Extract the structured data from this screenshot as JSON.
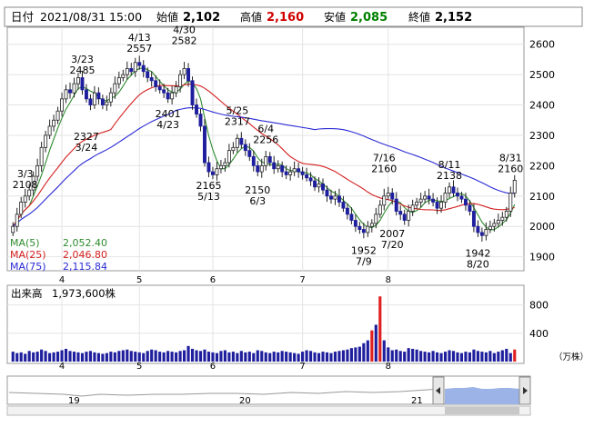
{
  "header": {
    "date_label": "日付",
    "datetime": "2021/08/31 15:00",
    "open_label": "始値",
    "open": "2,102",
    "high_label": "高値",
    "high": "2,160",
    "low_label": "安値",
    "low": "2,085",
    "close_label": "終値",
    "close": "2,152"
  },
  "colors": {
    "up": "#ffffff",
    "down": "#1f1f9e",
    "ma5": "#2e8b2e",
    "ma25": "#d42020",
    "ma75": "#2a2ad4",
    "high_value": "#d00000",
    "low_value": "#008000",
    "volume": "#1f1f9e",
    "volume_highlight": "#e02020",
    "navigator_fill": "#9bb3e6"
  },
  "legend": [
    {
      "label": "MA(5)",
      "value": "2,052.40",
      "color": "#2e8b2e"
    },
    {
      "label": "MA(25)",
      "value": "2,046.80",
      "color": "#d42020"
    },
    {
      "label": "MA(75)",
      "value": "2,115.84",
      "color": "#2a2ad4"
    }
  ],
  "volume_panel": {
    "label": "出来高",
    "value": "1,973,600株",
    "unit": "（万株）"
  },
  "chart_data": {
    "type": "candlestick",
    "y_ticks": [
      1900,
      2000,
      2100,
      2200,
      2300,
      2400,
      2500,
      2600
    ],
    "ylim": [
      1860,
      2650
    ],
    "x_month_labels": [
      {
        "label": "4",
        "index": 12
      },
      {
        "label": "5",
        "index": 31
      },
      {
        "label": "6",
        "index": 49
      },
      {
        "label": "7",
        "index": 71
      },
      {
        "label": "8",
        "index": 92
      }
    ],
    "annotations": [
      {
        "lines": [
          "3/3",
          "2108"
        ],
        "index": 3,
        "price": 2108
      },
      {
        "lines": [
          "3/23",
          "2485"
        ],
        "index": 17,
        "price": 2485
      },
      {
        "lines": [
          "2327",
          "3/24"
        ],
        "index": 18,
        "price": 2327
      },
      {
        "lines": [
          "4/13",
          "2557"
        ],
        "index": 31,
        "price": 2557
      },
      {
        "lines": [
          "2401",
          "4/23"
        ],
        "index": 38,
        "price": 2401
      },
      {
        "lines": [
          "4/30",
          "2582"
        ],
        "index": 42,
        "price": 2582
      },
      {
        "lines": [
          "2165",
          "5/13"
        ],
        "index": 48,
        "price": 2165
      },
      {
        "lines": [
          "5/25",
          "2317"
        ],
        "index": 55,
        "price": 2317
      },
      {
        "lines": [
          "6/4",
          "2256"
        ],
        "index": 62,
        "price": 2256
      },
      {
        "lines": [
          "2150",
          "6/3"
        ],
        "index": 60,
        "price": 2150
      },
      {
        "lines": [
          "1952",
          "7/9"
        ],
        "index": 86,
        "price": 1952
      },
      {
        "lines": [
          "7/16",
          "2160"
        ],
        "index": 91,
        "price": 2160
      },
      {
        "lines": [
          "2007",
          "7/20"
        ],
        "index": 93,
        "price": 2007
      },
      {
        "lines": [
          "8/11",
          "2138"
        ],
        "index": 107,
        "price": 2138
      },
      {
        "lines": [
          "1942",
          "8/20"
        ],
        "index": 114,
        "price": 1942
      },
      {
        "lines": [
          "8/31",
          "2160"
        ],
        "index": 122,
        "price": 2160
      }
    ],
    "volume_ticks": [
      400,
      800
    ],
    "volume_max": 1000,
    "volume_highlight_index": 90,
    "closes": [
      2000,
      2040,
      2080,
      2100,
      2120,
      2165,
      2200,
      2260,
      2300,
      2330,
      2350,
      2380,
      2420,
      2450,
      2440,
      2470,
      2490,
      2450,
      2420,
      2400,
      2440,
      2420,
      2400,
      2410,
      2440,
      2470,
      2490,
      2500,
      2520,
      2510,
      2540,
      2530,
      2510,
      2490,
      2480,
      2460,
      2450,
      2440,
      2420,
      2440,
      2460,
      2500,
      2520,
      2480,
      2400,
      2370,
      2330,
      2210,
      2180,
      2170,
      2190,
      2200,
      2210,
      2250,
      2260,
      2290,
      2270,
      2250,
      2230,
      2200,
      2180,
      2200,
      2230,
      2210,
      2190,
      2200,
      2180,
      2170,
      2180,
      2190,
      2180,
      2170,
      2160,
      2150,
      2130,
      2140,
      2120,
      2100,
      2090,
      2100,
      2080,
      2060,
      2040,
      2020,
      2000,
      1990,
      1980,
      2000,
      2010,
      2040,
      2070,
      2100,
      2110,
      2090,
      2050,
      2040,
      2020,
      2050,
      2070,
      2080,
      2090,
      2100,
      2090,
      2080,
      2060,
      2080,
      2110,
      2130,
      2110,
      2100,
      2090,
      2070,
      2050,
      2000,
      1980,
      1970,
      1990,
      2000,
      2010,
      2020,
      2030,
      2050,
      2110,
      2152
    ],
    "volume": [
      140,
      120,
      130,
      110,
      150,
      130,
      140,
      170,
      150,
      120,
      130,
      140,
      160,
      180,
      150,
      140,
      130,
      120,
      140,
      150,
      130,
      120,
      110,
      120,
      140,
      130,
      150,
      160,
      170,
      150,
      140,
      130,
      120,
      150,
      170,
      160,
      140,
      130,
      150,
      140,
      130,
      150,
      160,
      220,
      180,
      160,
      150,
      170,
      140,
      130,
      120,
      150,
      160,
      130,
      140,
      120,
      150,
      130,
      140,
      120,
      160,
      150,
      130,
      120,
      140,
      130,
      150,
      140,
      130,
      120,
      110,
      140,
      160,
      150,
      130,
      120,
      140,
      130,
      120,
      140,
      150,
      160,
      170,
      190,
      200,
      210,
      260,
      300,
      440,
      520,
      920,
      300,
      200,
      160,
      170,
      150,
      140,
      190,
      180,
      170,
      150,
      140,
      130,
      150,
      130,
      120,
      140,
      160,
      150,
      130,
      120,
      140,
      130,
      170,
      150,
      140,
      130,
      150,
      120,
      140,
      160,
      180,
      120,
      170
    ]
  }
}
